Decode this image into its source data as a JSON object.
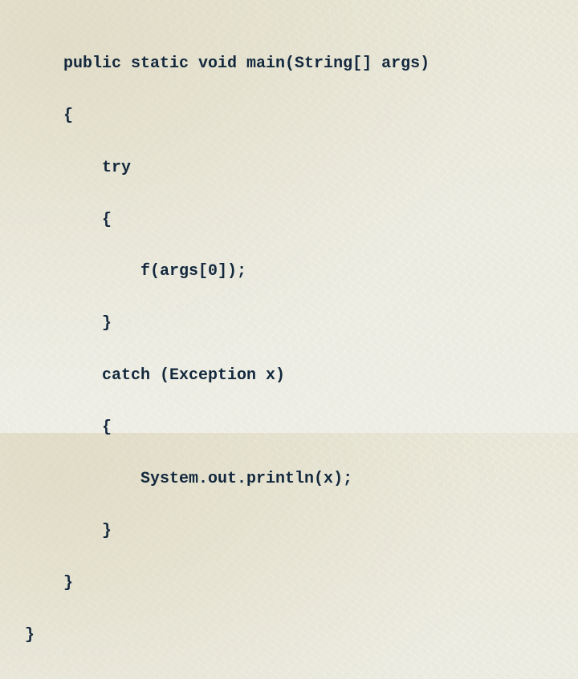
{
  "slide": {
    "code_language": "java",
    "text_color": "#13283d",
    "background_color": "#eae9dc",
    "code_lines": [
      "    public static void main(String[] args)",
      "    {",
      "        try",
      "        {",
      "            f(args[0]);",
      "        }",
      "        catch (Exception x)",
      "        {",
      "            System.out.println(x);",
      "        }",
      "    }",
      "}"
    ]
  }
}
